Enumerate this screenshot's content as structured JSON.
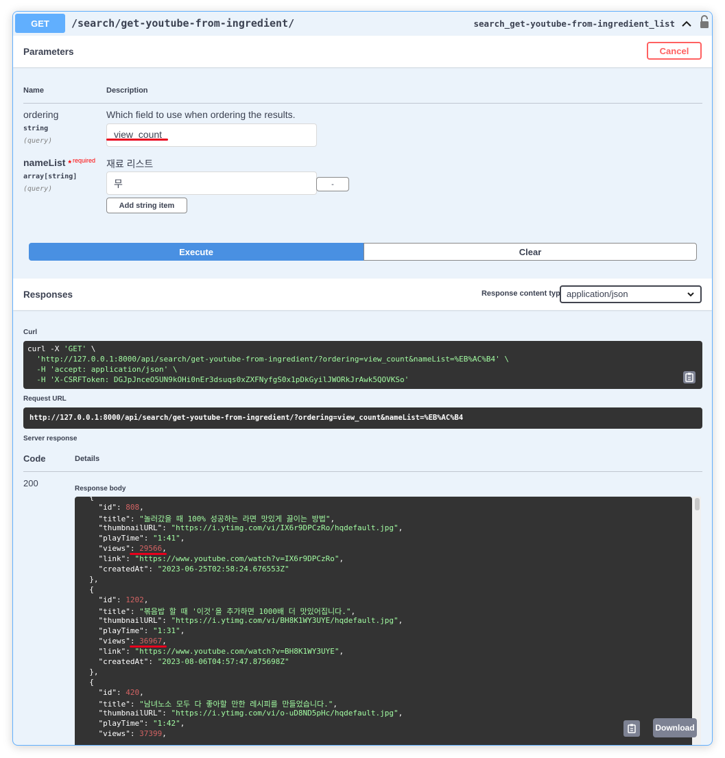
{
  "operation": {
    "method": "GET",
    "path": "/search/get-youtube-from-ingredient/",
    "operation_id": "search_get-youtube-from-ingredient_list"
  },
  "parameters": {
    "title": "Parameters",
    "cancel_label": "Cancel",
    "col_name": "Name",
    "col_description": "Description",
    "ordering": {
      "name": "ordering",
      "type": "string",
      "in": "(query)",
      "description": "Which field to use when ordering the results.",
      "value": "view_count"
    },
    "nameList": {
      "name": "nameList",
      "required_star": "*",
      "required_label": "required",
      "type": "array[string]",
      "in": "(query)",
      "description": "재료 리스트",
      "value": "무",
      "remove_label": "-",
      "add_label": "Add string item"
    },
    "execute_label": "Execute",
    "clear_label": "Clear"
  },
  "responses": {
    "title": "Responses",
    "content_type_label": "Response content type",
    "content_type_value": "application/json",
    "curl_label": "Curl",
    "curl_lines": [
      "curl -X 'GET' \\",
      "  'http://127.0.0.1:8000/api/search/get-youtube-from-ingredient/?ordering=view_count&nameList=%EB%AC%B4' \\",
      "  -H 'accept: application/json' \\",
      "  -H 'X-CSRFToken: DGJpJnceO5UN9kOHi0nEr3dsuqs0xZXFNyfgS0x1pDkGyilJWORkJrAwk5QOVKSo'"
    ],
    "request_url_label": "Request URL",
    "request_url": "http://127.0.0.1:8000/api/search/get-youtube-from-ingredient/?ordering=view_count&nameList=%EB%AC%B4",
    "server_response_label": "Server response",
    "code_header": "Code",
    "details_header": "Details",
    "status_code": "200",
    "response_body_label": "Response body",
    "download_label": "Download",
    "items": [
      {
        "id": "808",
        "title": "놀러갔을 때 100% 성공하는 라면 맛있게 끓이는 방법",
        "thumbnailURL": "https://i.ytimg.com/vi/IX6r9DPCzRo/hqdefault.jpg",
        "playTime": "1:41",
        "views": "29566",
        "link": "https://www.youtube.com/watch?v=IX6r9DPCzRo",
        "createdAt": "2023-06-25T02:58:24.676553Z"
      },
      {
        "id": "1202",
        "title": "볶음밥 할 때 '이것'을 추가하면 1000배 더 맛있어집니다.",
        "thumbnailURL": "https://i.ytimg.com/vi/BH8K1WY3UYE/hqdefault.jpg",
        "playTime": "1:31",
        "views": "36967",
        "link": "https://www.youtube.com/watch?v=BH8K1WY3UYE",
        "createdAt": "2023-08-06T04:57:47.875698Z"
      },
      {
        "id": "420",
        "title": "남녀노소 모두 다 좋아할 만한 레시피를 만들었습니다.",
        "thumbnailURL": "https://i.ytimg.com/vi/o-uD8ND5pHc/hqdefault.jpg",
        "playTime": "1:42",
        "views": "37399"
      }
    ]
  },
  "colors": {
    "get_blue": "#61affe",
    "execute_blue": "#4990e2",
    "cancel_red": "#ff6060",
    "annotation_red": "#e8001c",
    "code_bg": "#333333",
    "code_string": "#a2fca2",
    "code_number": "#d36363"
  }
}
